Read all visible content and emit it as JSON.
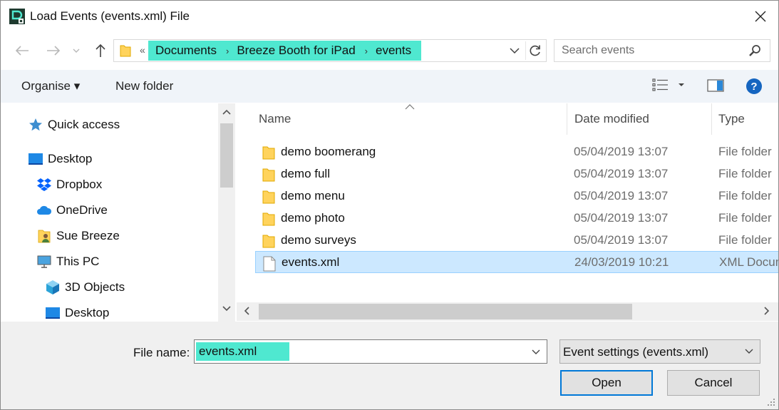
{
  "window": {
    "title": "Load Events (events.xml) File",
    "close_glyph": "✕"
  },
  "address": {
    "overflow_glyph": "«",
    "crumbs": [
      "Documents",
      "Breeze Booth for iPad",
      "events"
    ],
    "separator_glyph": "›"
  },
  "search": {
    "placeholder": "Search events"
  },
  "toolbar": {
    "organise_label": "Organise ▾",
    "new_folder_label": "New folder"
  },
  "nav": {
    "items": [
      {
        "label": "Quick access",
        "icon": "star-icon"
      },
      {
        "label": "Desktop",
        "icon": "desktop-icon"
      },
      {
        "label": "Dropbox",
        "icon": "dropbox-icon"
      },
      {
        "label": "OneDrive",
        "icon": "cloud-icon"
      },
      {
        "label": "Sue Breeze",
        "icon": "user-folder-icon"
      },
      {
        "label": "This PC",
        "icon": "computer-icon"
      },
      {
        "label": "3D Objects",
        "icon": "cube-icon"
      },
      {
        "label": "Desktop",
        "icon": "desktop-icon"
      }
    ]
  },
  "files": {
    "columns": [
      "Name",
      "Date modified",
      "Type"
    ],
    "rows": [
      {
        "name": "demo boomerang",
        "date": "05/04/2019 13:07",
        "type": "File folder",
        "icon": "folder-icon"
      },
      {
        "name": "demo full",
        "date": "05/04/2019 13:07",
        "type": "File folder",
        "icon": "folder-icon"
      },
      {
        "name": "demo menu",
        "date": "05/04/2019 13:07",
        "type": "File folder",
        "icon": "folder-icon"
      },
      {
        "name": "demo photo",
        "date": "05/04/2019 13:07",
        "type": "File folder",
        "icon": "folder-icon"
      },
      {
        "name": "demo surveys",
        "date": "05/04/2019 13:07",
        "type": "File folder",
        "icon": "folder-icon"
      },
      {
        "name": "events.xml",
        "date": "24/03/2019 10:21",
        "type": "XML Document",
        "icon": "document-icon",
        "selected": true
      }
    ]
  },
  "bottom": {
    "file_name_label": "File name:",
    "file_name_value": "events.xml",
    "filter_value": "Event settings (events.xml)",
    "open_label": "Open",
    "cancel_label": "Cancel"
  },
  "colors": {
    "highlight": "#4fe8d0",
    "selection": "#cce8ff",
    "accent": "#0078d7"
  }
}
